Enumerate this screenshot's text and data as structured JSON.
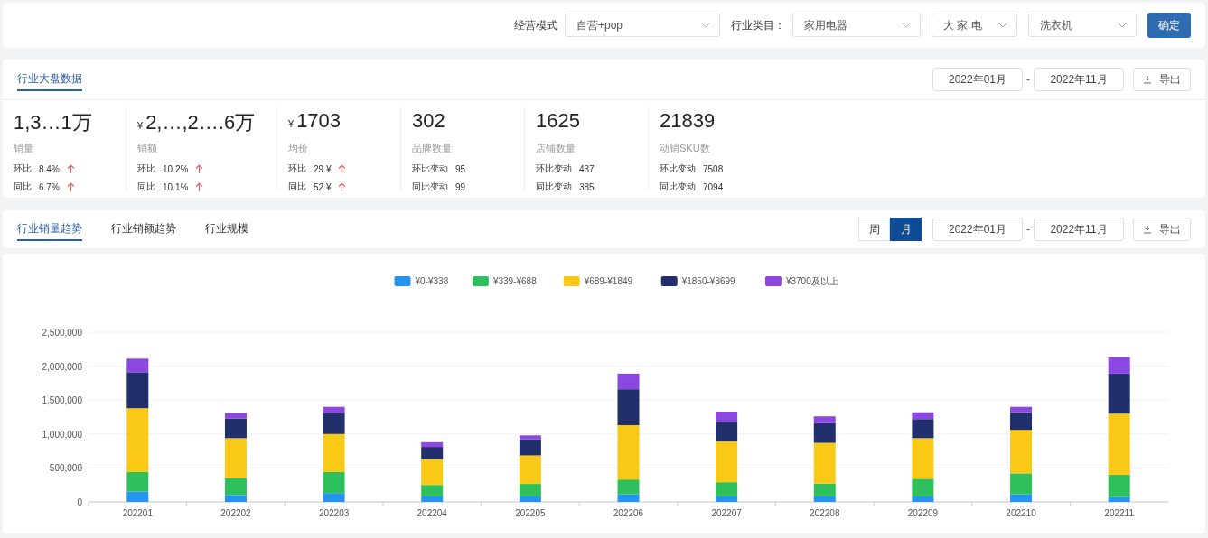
{
  "filters": [
    {
      "label": "经营模式",
      "value": "自营+pop"
    },
    {
      "label": "行业类目：",
      "value": "家用电器"
    },
    {
      "value": "大 家 电"
    },
    {
      "value": "洗衣机"
    }
  ],
  "confirm_button": "确定",
  "overview": {
    "tabs": [
      {
        "label": "行业大盘数据",
        "selected": true
      }
    ],
    "date_from": "2022年01月",
    "date_sep": "-",
    "date_to": "2022年11月",
    "export": "导出",
    "stats": [
      {
        "value": "1,3…1万",
        "label": "销量",
        "rows": [
          {
            "label": "环比",
            "value": "8.4%",
            "up": true
          },
          {
            "label": "同比",
            "value": "6.7%",
            "up": true
          }
        ]
      },
      {
        "prefix": "¥",
        "value": "2,…,2….6万",
        "label": "销额",
        "rows": [
          {
            "label": "环比",
            "value": "10.2%",
            "up": true
          },
          {
            "label": "同比",
            "value": "10.1%",
            "up": true
          }
        ]
      },
      {
        "prefix": "¥",
        "value": "1703",
        "label": "均价",
        "rows": [
          {
            "label": "环比",
            "value": "29 ¥",
            "up": true
          },
          {
            "label": "同比",
            "value": "52 ¥",
            "up": true
          }
        ]
      },
      {
        "value": "302",
        "label": "品牌数量",
        "rows": [
          {
            "label": "环比变动",
            "value": "95"
          },
          {
            "label": "同比变动",
            "value": "99"
          }
        ]
      },
      {
        "value": "1625",
        "label": "店铺数量",
        "rows": [
          {
            "label": "环比变动",
            "value": "437"
          },
          {
            "label": "同比变动",
            "value": "385"
          }
        ]
      },
      {
        "value": "21839",
        "label": "动销SKU数",
        "rows": [
          {
            "label": "环比变动",
            "value": "7508"
          },
          {
            "label": "同比变动",
            "value": "7094"
          }
        ]
      }
    ]
  },
  "trend": {
    "tabs": [
      {
        "label": "行业销量趋势",
        "selected": true
      },
      {
        "label": "行业销额趋势",
        "selected": false
      },
      {
        "label": "行业规模",
        "selected": false
      }
    ],
    "periods": [
      {
        "label": "周",
        "selected": false
      },
      {
        "label": "月",
        "selected": true
      }
    ],
    "date_from": "2022年01月",
    "date_sep": "-",
    "date_to": "2022年11月",
    "export": "导出",
    "chart_data": {
      "type": "bar",
      "stacked": true,
      "grid": true,
      "legend": "top",
      "categories": [
        "202201",
        "202202",
        "202203",
        "202204",
        "202205",
        "202206",
        "202207",
        "202208",
        "202209",
        "202210",
        "202211"
      ],
      "ylim": [
        0,
        2500000
      ],
      "yticks": [
        {
          "value": 0,
          "label": "0"
        },
        {
          "value": 500000,
          "label": "500,000"
        },
        {
          "value": 1000000,
          "label": "1,000,000"
        },
        {
          "value": 1500000,
          "label": "1,500,000"
        },
        {
          "value": 2000000,
          "label": "2,000,000"
        },
        {
          "value": 2500000,
          "label": "2,500,000"
        }
      ],
      "series": [
        {
          "name": "¥0-¥338",
          "color": "#2493f2",
          "values": [
            150000,
            100000,
            130000,
            80000,
            80000,
            110000,
            80000,
            80000,
            80000,
            110000,
            70000
          ]
        },
        {
          "name": "¥339-¥688",
          "color": "#2fc05e",
          "values": [
            290000,
            250000,
            310000,
            170000,
            185000,
            220000,
            210000,
            190000,
            260000,
            310000,
            330000
          ]
        },
        {
          "name": "¥689-¥1849",
          "color": "#f9c916",
          "values": [
            940000,
            590000,
            560000,
            380000,
            420000,
            800000,
            600000,
            600000,
            600000,
            640000,
            900000
          ]
        },
        {
          "name": "¥1850-¥3699",
          "color": "#21306c",
          "values": [
            530000,
            290000,
            310000,
            180000,
            235000,
            530000,
            290000,
            290000,
            280000,
            260000,
            590000
          ]
        },
        {
          "name": "¥3700及以上",
          "color": "#8b47e0",
          "values": [
            200000,
            80000,
            90000,
            70000,
            60000,
            230000,
            150000,
            100000,
            100000,
            80000,
            240000
          ]
        }
      ]
    }
  }
}
